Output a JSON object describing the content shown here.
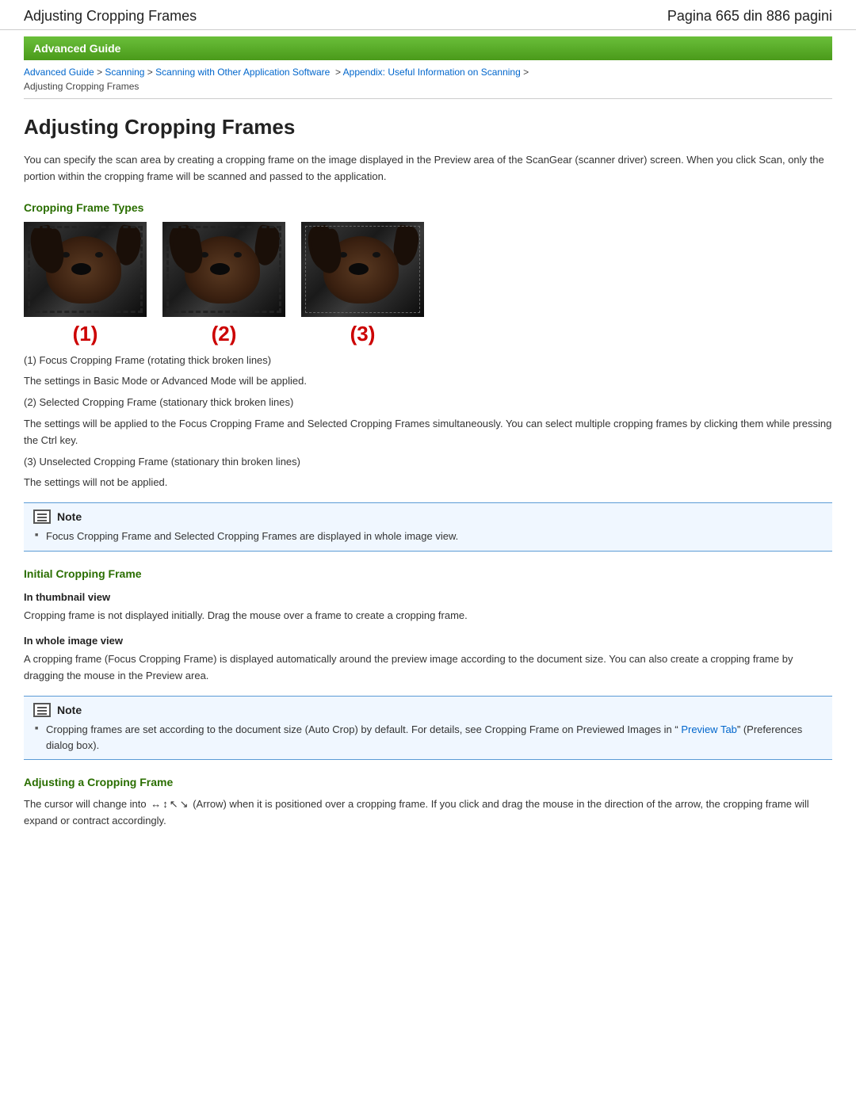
{
  "topbar": {
    "title": "Adjusting Cropping Frames",
    "page_info": "Pagina 665 din 886 pagini"
  },
  "guide_header": "Advanced Guide",
  "breadcrumb": {
    "items": [
      {
        "label": "Advanced Guide",
        "href": "#"
      },
      {
        "label": "Scanning",
        "href": "#"
      },
      {
        "label": "Scanning with Other Application Software",
        "href": "#"
      },
      {
        "label": "Appendix: Useful Information on Scanning",
        "href": "#"
      },
      {
        "label": "Adjusting Cropping Frames",
        "href": null
      }
    ]
  },
  "page_title": "Adjusting Cropping Frames",
  "intro": "You can specify the scan area by creating a cropping frame on the image displayed in the Preview area of the ScanGear (scanner driver) screen. When you click Scan, only the portion within the cropping frame will be scanned and passed to the application.",
  "section_cropping_frame_types": {
    "heading": "Cropping Frame Types",
    "frames": [
      {
        "label": "(1)",
        "type": "focus"
      },
      {
        "label": "(2)",
        "type": "selected"
      },
      {
        "label": "(3)",
        "type": "unselected"
      }
    ]
  },
  "frame_desc": [
    {
      "item": "(1) Focus Cropping Frame (rotating thick broken lines)",
      "detail": "The settings in Basic Mode or Advanced Mode will be applied."
    },
    {
      "item": "(2) Selected Cropping Frame (stationary thick broken lines)",
      "detail": "The settings will be applied to the Focus Cropping Frame and Selected Cropping Frames simultaneously. You can select multiple cropping frames by clicking them while pressing the Ctrl key."
    },
    {
      "item": "(3) Unselected Cropping Frame (stationary thin broken lines)",
      "detail": "The settings will not be applied."
    }
  ],
  "note1": {
    "title": "Note",
    "items": [
      "Focus Cropping Frame and Selected Cropping Frames are displayed in whole image view."
    ]
  },
  "section_initial": {
    "heading": "Initial Cropping Frame",
    "thumbnail_heading": "In thumbnail view",
    "thumbnail_text": "Cropping frame is not displayed initially. Drag the mouse over a frame to create a cropping frame.",
    "whole_heading": "In whole image view",
    "whole_text": "A cropping frame (Focus Cropping Frame) is displayed automatically around the preview image according to the document size. You can also create a cropping frame by dragging the mouse in the Preview area."
  },
  "note2": {
    "title": "Note",
    "items": [
      "Cropping frames are set according to the document size (Auto Crop) by default. For details, see Cropping Frame on Previewed Images in “ Preview Tab” (Preferences dialog box)."
    ],
    "link_text": "Preview Tab"
  },
  "section_adjusting": {
    "heading": "Adjusting a Cropping Frame",
    "text_before": "The cursor will change into",
    "text_after": "(Arrow) when it is positioned over a cropping frame. If you click and drag the mouse in the direction of the arrow, the cropping frame will expand or contract accordingly."
  }
}
